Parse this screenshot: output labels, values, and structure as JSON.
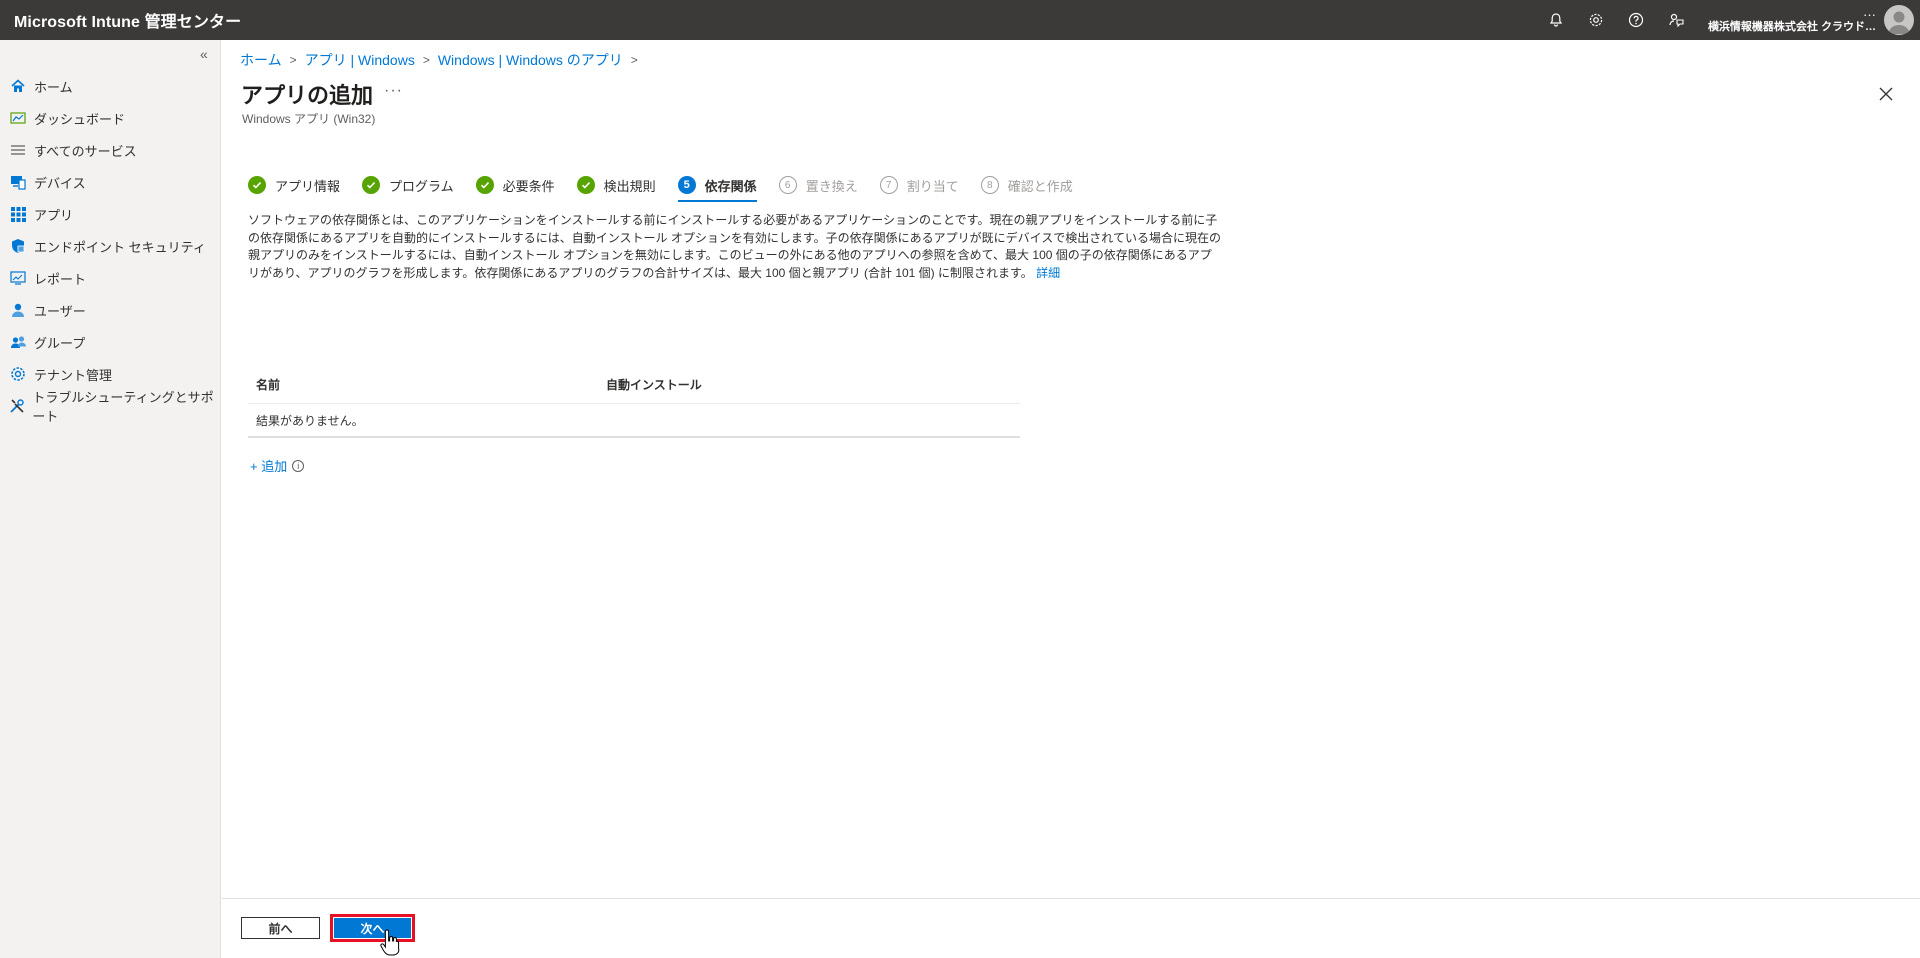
{
  "header": {
    "app_title": "Microsoft Intune 管理センター",
    "account_dots": "···",
    "account_org": "横浜情報機器株式会社 クラウド…",
    "icons": [
      "bell-icon",
      "gear-icon",
      "help-icon",
      "feedback-icon",
      "avatar"
    ]
  },
  "sidebar": {
    "collapse_label": "«",
    "items": [
      {
        "label": "ホーム",
        "icon": "home-icon"
      },
      {
        "label": "ダッシュボード",
        "icon": "dashboard-icon"
      },
      {
        "label": "すべてのサービス",
        "icon": "list-icon"
      },
      {
        "label": "デバイス",
        "icon": "device-icon"
      },
      {
        "label": "アプリ",
        "icon": "apps-grid-icon"
      },
      {
        "label": "エンドポイント セキュリティ",
        "icon": "shield-icon"
      },
      {
        "label": "レポート",
        "icon": "report-icon"
      },
      {
        "label": "ユーザー",
        "icon": "user-icon"
      },
      {
        "label": "グループ",
        "icon": "group-icon"
      },
      {
        "label": "テナント管理",
        "icon": "tenant-icon"
      },
      {
        "label": "トラブルシューティングとサポート",
        "icon": "tools-icon"
      }
    ]
  },
  "breadcrumb": [
    "ホーム",
    "アプリ | Windows",
    "Windows | Windows のアプリ"
  ],
  "page": {
    "title": "アプリの追加",
    "more": "···",
    "subtitle": "Windows アプリ (Win32)"
  },
  "steps": [
    {
      "num": "1",
      "label": "アプリ情報",
      "state": "done"
    },
    {
      "num": "2",
      "label": "プログラム",
      "state": "done"
    },
    {
      "num": "3",
      "label": "必要条件",
      "state": "done"
    },
    {
      "num": "4",
      "label": "検出規則",
      "state": "done"
    },
    {
      "num": "5",
      "label": "依存関係",
      "state": "active"
    },
    {
      "num": "6",
      "label": "置き換え",
      "state": "future"
    },
    {
      "num": "7",
      "label": "割り当て",
      "state": "future"
    },
    {
      "num": "8",
      "label": "確認と作成",
      "state": "future"
    }
  ],
  "description": {
    "text": "ソフトウェアの依存関係とは、このアプリケーションをインストールする前にインストールする必要があるアプリケーションのことです。現在の親アプリをインストールする前に子の依存関係にあるアプリを自動的にインストールするには、自動インストール オプションを有効にします。子の依存関係にあるアプリが既にデバイスで検出されている場合に現在の親アプリのみをインストールするには、自動インストール オプションを無効にします。このビューの外にある他のアプリへの参照を含めて、最大 100 個の子の依存関係にあるアプリがあり、アプリのグラフを形成します。依存関係にあるアプリのグラフの合計サイズは、最大 100 個と親アプリ (合計 101 個) に制限されます。",
    "link": "詳細"
  },
  "table": {
    "columns": [
      "名前",
      "自動インストール"
    ],
    "empty_text": "結果がありません。"
  },
  "add": {
    "label": "+ 追加",
    "info": "i"
  },
  "footer": {
    "prev_label": "前へ",
    "next_label": "次へ"
  },
  "colors": {
    "topbar": "#3b3a39",
    "accent": "#0078d4",
    "success": "#57a300",
    "highlight_border": "#e81123"
  }
}
